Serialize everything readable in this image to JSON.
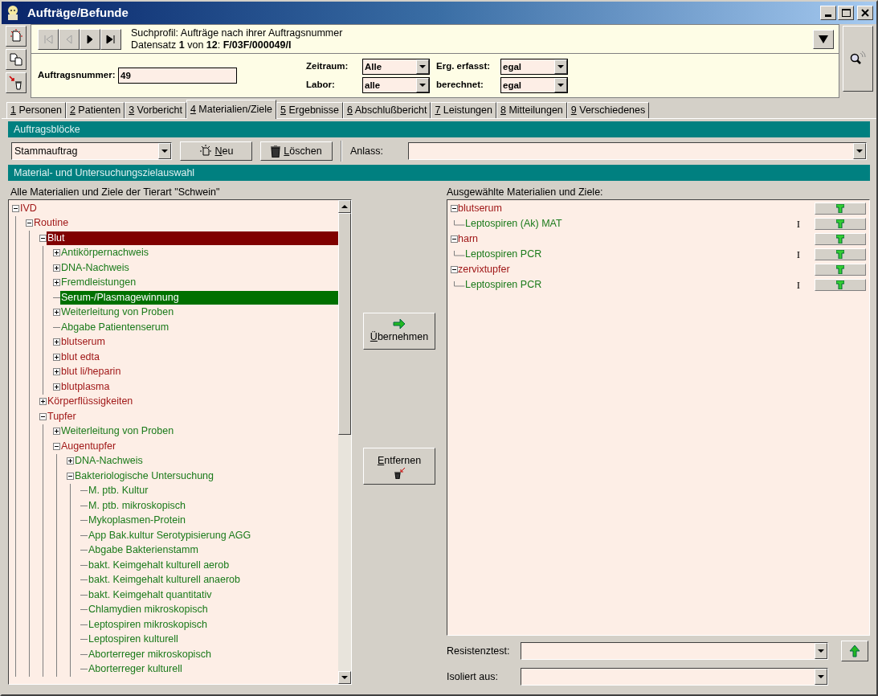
{
  "window": {
    "title": "Aufträge/Befunde"
  },
  "search_profile": {
    "line1": "Suchprofil: Aufträge nach ihrer Auftragsnummer",
    "line2": "Datensatz **1** von **12**: **F/03F/000049/I**"
  },
  "nav_buttons": [
    {
      "kind": "first",
      "disabled": true
    },
    {
      "kind": "prev",
      "disabled": true
    },
    {
      "kind": "next",
      "disabled": false
    },
    {
      "kind": "last",
      "disabled": false
    }
  ],
  "order_number": {
    "label": "Auftragsnummer:",
    "value": "49"
  },
  "filters": [
    {
      "label": "Zeitraum:",
      "value": "Alle"
    },
    {
      "label": "Erg. erfasst:",
      "value": "egal"
    },
    {
      "label": "Labor:",
      "value": "alle"
    },
    {
      "label": "berechnet:",
      "value": "egal"
    }
  ],
  "tabs": [
    {
      "hotkey": "1",
      "label": "Personen",
      "selected": false
    },
    {
      "hotkey": "2",
      "label": "Patienten",
      "selected": false
    },
    {
      "hotkey": "3",
      "label": "Vorbericht",
      "selected": false
    },
    {
      "hotkey": "4",
      "label": "Materialien/Ziele",
      "selected": true
    },
    {
      "hotkey": "5",
      "label": "Ergebnisse",
      "selected": false
    },
    {
      "hotkey": "6",
      "label": "Abschlußbericht",
      "selected": false
    },
    {
      "hotkey": "7",
      "label": "Leistungen",
      "selected": false
    },
    {
      "hotkey": "8",
      "label": "Mitteilungen",
      "selected": false
    },
    {
      "hotkey": "9",
      "label": "Verschiedenes",
      "selected": false
    }
  ],
  "blocks": {
    "header": "Auftragsblöcke",
    "block_select": "Stammauftrag",
    "new_button": "Neu",
    "delete_button": "Löschen",
    "reason_label": "Anlass:"
  },
  "selection": {
    "header": "Material- und Untersuchungszielauswahl",
    "left_label": "Alle Materialien und Ziele der Tierart \"Schwein\"",
    "right_label": "Ausgewählte Materialien und Ziele:",
    "add_button": "Übernehmen",
    "remove_button": "Entfernen"
  },
  "tree": [
    {
      "label": "IVD",
      "kind": "material",
      "expanded": true,
      "selected": false,
      "children": [
        {
          "label": "Routine",
          "kind": "material",
          "expanded": true,
          "selected": false,
          "children": [
            {
              "label": "Blut",
              "kind": "material",
              "expanded": true,
              "selected": true,
              "children": [
                {
                  "label": "Antikörpernachweis",
                  "kind": "target",
                  "expanded": false,
                  "selected": false
                },
                {
                  "label": "DNA-Nachweis",
                  "kind": "target",
                  "expanded": false,
                  "selected": false
                },
                {
                  "label": "Fremdleistungen",
                  "kind": "target",
                  "expanded": false,
                  "selected": false
                },
                {
                  "label": "Serum-/Plasmagewinnung",
                  "kind": "target",
                  "selected": true
                },
                {
                  "label": "Weiterleitung von Proben",
                  "kind": "target",
                  "expanded": false,
                  "selected": false
                },
                {
                  "label": "Abgabe Patientenserum",
                  "kind": "target",
                  "selected": false
                },
                {
                  "label": "blutserum",
                  "kind": "material",
                  "expanded": false,
                  "selected": false
                },
                {
                  "label": "blut edta",
                  "kind": "material",
                  "expanded": false,
                  "selected": false
                },
                {
                  "label": "blut li/heparin",
                  "kind": "material",
                  "expanded": false,
                  "selected": false
                },
                {
                  "label": "blutplasma",
                  "kind": "material",
                  "expanded": false,
                  "selected": false
                }
              ]
            },
            {
              "label": "Körperflüssigkeiten",
              "kind": "material",
              "expanded": false,
              "selected": false
            },
            {
              "label": "Tupfer",
              "kind": "material",
              "expanded": true,
              "selected": false,
              "children": [
                {
                  "label": "Weiterleitung von Proben",
                  "kind": "target",
                  "expanded": false,
                  "selected": false
                },
                {
                  "label": "Augentupfer",
                  "kind": "material",
                  "expanded": true,
                  "selected": false,
                  "children": [
                    {
                      "label": "DNA-Nachweis",
                      "kind": "target",
                      "expanded": false,
                      "selected": false
                    },
                    {
                      "label": "Bakteriologische Untersuchung",
                      "kind": "target",
                      "expanded": true,
                      "selected": false,
                      "children": [
                        {
                          "label": "M. ptb. Kultur",
                          "kind": "target",
                          "selected": false
                        },
                        {
                          "label": "M. ptb. mikroskopisch",
                          "kind": "target",
                          "selected": false
                        },
                        {
                          "label": "Mykoplasmen-Protein",
                          "kind": "target",
                          "selected": false
                        },
                        {
                          "label": "App Bak.kultur Serotypisierung AGG",
                          "kind": "target",
                          "selected": false
                        },
                        {
                          "label": "Abgabe Bakterienstamm",
                          "kind": "target",
                          "selected": false
                        },
                        {
                          "label": "bakt. Keimgehalt kulturell aerob",
                          "kind": "target",
                          "selected": false
                        },
                        {
                          "label": "bakt. Keimgehalt kulturell anaerob",
                          "kind": "target",
                          "selected": false
                        },
                        {
                          "label": "bakt. Keimgehalt quantitativ",
                          "kind": "target",
                          "selected": false
                        },
                        {
                          "label": "Chlamydien mikroskopisch",
                          "kind": "target",
                          "selected": false
                        },
                        {
                          "label": "Leptospiren mikroskopisch",
                          "kind": "target",
                          "selected": false
                        },
                        {
                          "label": "Leptospiren kulturell",
                          "kind": "target",
                          "selected": false
                        },
                        {
                          "label": "Aborterreger mikroskopisch",
                          "kind": "target",
                          "selected": false
                        },
                        {
                          "label": "Aborterreger kulturell",
                          "kind": "target",
                          "selected": false
                        }
                      ]
                    }
                  ]
                }
              ]
            }
          ]
        }
      ]
    }
  ],
  "selected_items": [
    {
      "label": "blutserum",
      "kind": "material",
      "children": [
        {
          "label": "Leptospiren (Ak) MAT",
          "kind": "target",
          "flag": "I"
        }
      ]
    },
    {
      "label": "harn",
      "kind": "material",
      "children": [
        {
          "label": "Leptospiren PCR",
          "kind": "target",
          "flag": "I"
        }
      ]
    },
    {
      "label": "zervixtupfer",
      "kind": "material",
      "children": [
        {
          "label": "Leptospiren PCR",
          "kind": "target",
          "flag": "I"
        }
      ]
    }
  ],
  "bottom_fields": [
    {
      "label": "Resistenztest:"
    },
    {
      "label": "Isoliert aus:"
    }
  ]
}
